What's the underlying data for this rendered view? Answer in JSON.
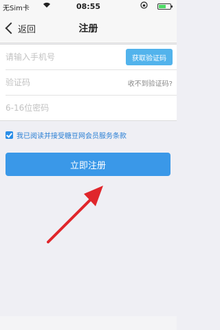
{
  "status_bar": {
    "carrier": "无Sim卡",
    "time": "08:55",
    "battery_level": 0.6
  },
  "nav": {
    "back_label": "返回",
    "title": "注册"
  },
  "form": {
    "phone_placeholder": "请输入手机号",
    "get_code_label": "获取验证码",
    "code_placeholder": "验证码",
    "no_code_label": "收不到验证码?",
    "password_placeholder": "6-16位密码"
  },
  "agreement": {
    "checked": true,
    "text": "我已阅读并接受糖豆网会员服务条款"
  },
  "register_button": "立即注册",
  "colors": {
    "primary": "#3a98e8",
    "get_code": "#52b3ec",
    "annotation_arrow": "#e0262b"
  },
  "icons": [
    "wifi-icon",
    "lock-rotation-icon",
    "battery-icon",
    "back-chevron-icon",
    "checkbox-icon",
    "red-arrow-icon"
  ]
}
